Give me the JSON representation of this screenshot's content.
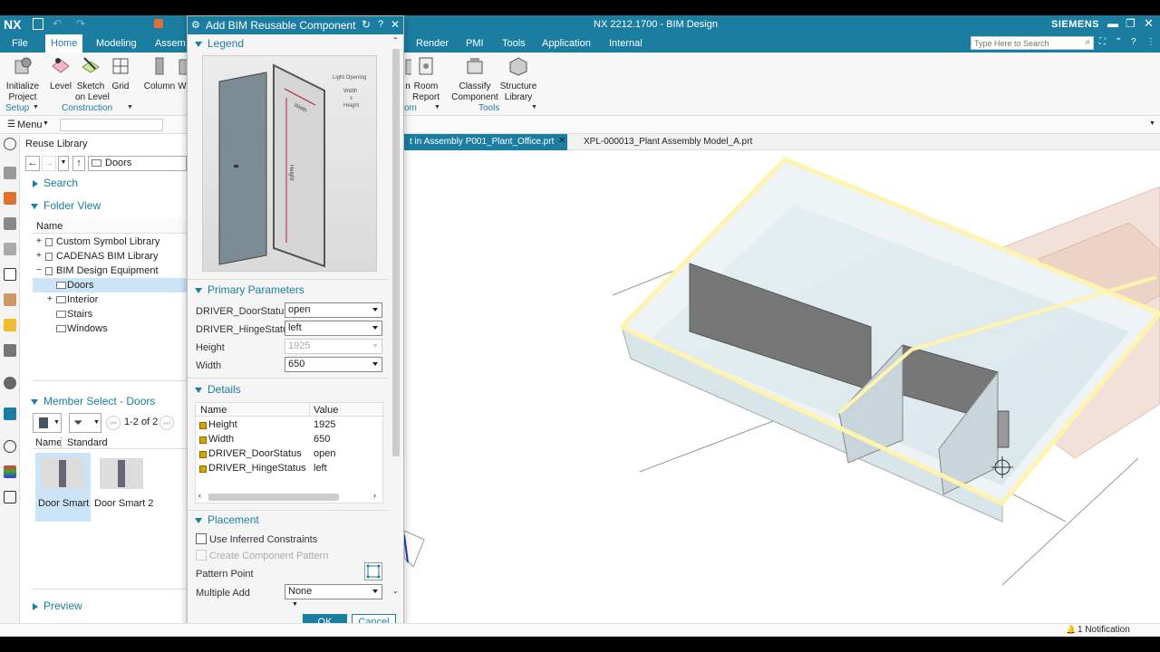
{
  "app": {
    "logo": "NX",
    "title": "NX 2212.1700 - BIM Design",
    "brand": "SIEMENS",
    "search_placeholder": "Type Here to Search"
  },
  "menu_tabs": [
    "File",
    "Home",
    "Modeling",
    "Assem",
    "Render",
    "PMI",
    "Tools",
    "Application",
    "Internal"
  ],
  "ribbon": {
    "left_buttons": [
      {
        "label": "Initialize\nProject",
        "icon": "initialize-project-icon"
      },
      {
        "label": "Level",
        "icon": "level-icon"
      },
      {
        "label": "Sketch\non Level",
        "icon": "sketch-on-level-icon"
      },
      {
        "label": "Grid",
        "icon": "grid-icon"
      },
      {
        "label": "Column",
        "icon": "column-icon"
      },
      {
        "label": "W",
        "icon": "wall-icon"
      }
    ],
    "right_buttons": [
      {
        "label": "n",
        "icon": "partial-icon"
      },
      {
        "label": "Room\nReport",
        "icon": "room-report-icon"
      },
      {
        "label": "Classify\nComponent",
        "icon": "classify-component-icon"
      },
      {
        "label": "Structure\nLibrary",
        "icon": "structure-library-icon"
      }
    ],
    "groups": {
      "setup": "Setup",
      "construction": "Construction",
      "om": "om",
      "tools": "Tools"
    }
  },
  "cmdbar": {
    "menu_label": "Menu"
  },
  "reuse_library": {
    "title": "Reuse Library",
    "path": "Doors",
    "search": "Search",
    "folder_view": "Folder View",
    "column_name": "Name",
    "tree": [
      {
        "label": "Custom Symbol Library",
        "level": 0,
        "expander": "+"
      },
      {
        "label": "CADENAS BIM Library",
        "level": 0,
        "expander": "+"
      },
      {
        "label": "BIM Design Equipment",
        "level": 0,
        "expander": "−"
      },
      {
        "label": "Doors",
        "level": 1,
        "expander": "",
        "selected": true
      },
      {
        "label": "Interior",
        "level": 1,
        "expander": "+"
      },
      {
        "label": "Stairs",
        "level": 1,
        "expander": ""
      },
      {
        "label": "Windows",
        "level": 1,
        "expander": ""
      }
    ],
    "member_select": "Member Select - Doors",
    "pager": "1-2 of 2",
    "member_cols": [
      "Name",
      "Standard"
    ],
    "members": [
      "Door Smart",
      "Door Smart 2"
    ],
    "preview": "Preview"
  },
  "dialog": {
    "title": "Add BIM Reusable Component",
    "legend": "Legend",
    "legend_labels": {
      "light_opening": "Light Opening",
      "width_x_height": "Width\nx\nHeight",
      "width": "Width",
      "height": "Height"
    },
    "primary_parameters": "Primary Parameters",
    "params": [
      {
        "label": "DRIVER_DoorStatus",
        "value": "open",
        "disabled": false
      },
      {
        "label": "DRIVER_HingeStatus",
        "value": "left",
        "disabled": false
      },
      {
        "label": "Height",
        "value": "1925",
        "disabled": true
      },
      {
        "label": "Width",
        "value": "650",
        "disabled": false
      }
    ],
    "details": "Details",
    "details_cols": [
      "Name",
      "Value"
    ],
    "details_rows": [
      {
        "name": "Height",
        "value": "1925"
      },
      {
        "name": "Width",
        "value": "650"
      },
      {
        "name": "DRIVER_DoorStatus",
        "value": "open"
      },
      {
        "name": "DRIVER_HingeStatus",
        "value": "left"
      }
    ],
    "placement": "Placement",
    "use_inferred": "Use Inferred Constraints",
    "create_pattern": "Create Component Pattern",
    "pattern_point": "Pattern Point",
    "multiple_add": "Multiple Add",
    "multiple_add_value": "None",
    "ok": "OK",
    "cancel": "Cancel"
  },
  "tabs": [
    {
      "label": "t in Assembly P001_Plant_Office.prt",
      "active": true
    },
    {
      "label": "XPL-000013_Plant Assembly Model_A.prt",
      "active": false
    }
  ],
  "status": {
    "notification": "1 Notification"
  },
  "colors": {
    "accent": "#1b7ea0",
    "highlight": "#fff8b0",
    "selection": "#cce4f7"
  }
}
